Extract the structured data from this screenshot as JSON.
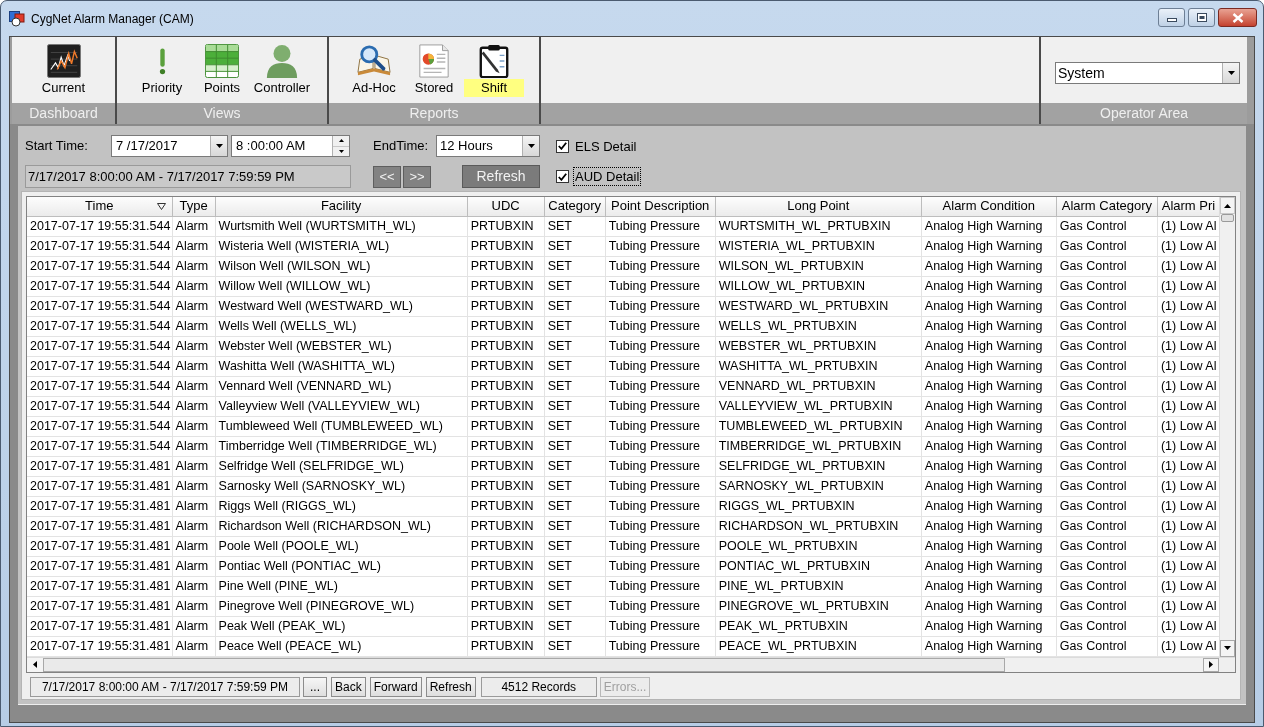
{
  "window": {
    "title": "CygNet Alarm Manager (CAM)"
  },
  "toolbar": {
    "groups": [
      {
        "label": "Dashboard",
        "items": [
          {
            "label": "Current",
            "selected": false
          }
        ]
      },
      {
        "label": "Views",
        "items": [
          {
            "label": "Priority",
            "selected": false
          },
          {
            "label": "Points",
            "selected": false
          },
          {
            "label": "Controller",
            "selected": false
          }
        ]
      },
      {
        "label": "Reports",
        "items": [
          {
            "label": "Ad-Hoc",
            "selected": false
          },
          {
            "label": "Stored",
            "selected": false
          },
          {
            "label": "Shift",
            "selected": true
          }
        ]
      }
    ]
  },
  "operator_area": {
    "label": "Operator Area",
    "value": "System"
  },
  "filters": {
    "start_label": "Start Time:",
    "start_date": "7 /17/2017",
    "start_time": "8 :00:00 AM",
    "end_label": "EndTime:",
    "end_value": "12 Hours",
    "range": "7/17/2017 8:00:00 AM - 7/17/2017 7:59:59 PM",
    "prev_button": "<<",
    "next_button": ">>",
    "refresh_button": "Refresh",
    "options": [
      {
        "label": "ELS Detail",
        "checked": true,
        "focused": false
      },
      {
        "label": "AUD Detail",
        "checked": true,
        "focused": true
      }
    ]
  },
  "table": {
    "columns": [
      {
        "label": "Time",
        "sorted": true
      },
      {
        "label": "Type",
        "sorted": false
      },
      {
        "label": "Facility",
        "sorted": false
      },
      {
        "label": "UDC",
        "sorted": false
      },
      {
        "label": "Category",
        "sorted": false
      },
      {
        "label": "Point Description",
        "sorted": false
      },
      {
        "label": "Long Point",
        "sorted": false
      },
      {
        "label": "Alarm Condition",
        "sorted": false
      },
      {
        "label": "Alarm Category",
        "sorted": false
      },
      {
        "label": "Alarm Pri",
        "sorted": false
      }
    ],
    "rows": [
      [
        "2017-07-17 19:55:31.544",
        "Alarm",
        "Wurtsmith Well (WURTSMITH_WL)",
        "PRTUBXIN",
        "SET",
        "Tubing Pressure",
        "WURTSMITH_WL_PRTUBXIN",
        "Analog High Warning",
        "Gas Control",
        "(1) Low Al"
      ],
      [
        "2017-07-17 19:55:31.544",
        "Alarm",
        "Wisteria Well (WISTERIA_WL)",
        "PRTUBXIN",
        "SET",
        "Tubing Pressure",
        "WISTERIA_WL_PRTUBXIN",
        "Analog High Warning",
        "Gas Control",
        "(1) Low Al"
      ],
      [
        "2017-07-17 19:55:31.544",
        "Alarm",
        "Wilson Well (WILSON_WL)",
        "PRTUBXIN",
        "SET",
        "Tubing Pressure",
        "WILSON_WL_PRTUBXIN",
        "Analog High Warning",
        "Gas Control",
        "(1) Low Al"
      ],
      [
        "2017-07-17 19:55:31.544",
        "Alarm",
        "Willow Well (WILLOW_WL)",
        "PRTUBXIN",
        "SET",
        "Tubing Pressure",
        "WILLOW_WL_PRTUBXIN",
        "Analog High Warning",
        "Gas Control",
        "(1) Low Al"
      ],
      [
        "2017-07-17 19:55:31.544",
        "Alarm",
        "Westward Well (WESTWARD_WL)",
        "PRTUBXIN",
        "SET",
        "Tubing Pressure",
        "WESTWARD_WL_PRTUBXIN",
        "Analog High Warning",
        "Gas Control",
        "(1) Low Al"
      ],
      [
        "2017-07-17 19:55:31.544",
        "Alarm",
        "Wells Well (WELLS_WL)",
        "PRTUBXIN",
        "SET",
        "Tubing Pressure",
        "WELLS_WL_PRTUBXIN",
        "Analog High Warning",
        "Gas Control",
        "(1) Low Al"
      ],
      [
        "2017-07-17 19:55:31.544",
        "Alarm",
        "Webster Well (WEBSTER_WL)",
        "PRTUBXIN",
        "SET",
        "Tubing Pressure",
        "WEBSTER_WL_PRTUBXIN",
        "Analog High Warning",
        "Gas Control",
        "(1) Low Al"
      ],
      [
        "2017-07-17 19:55:31.544",
        "Alarm",
        "Washitta Well (WASHITTA_WL)",
        "PRTUBXIN",
        "SET",
        "Tubing Pressure",
        "WASHITTA_WL_PRTUBXIN",
        "Analog High Warning",
        "Gas Control",
        "(1) Low Al"
      ],
      [
        "2017-07-17 19:55:31.544",
        "Alarm",
        "Vennard Well (VENNARD_WL)",
        "PRTUBXIN",
        "SET",
        "Tubing Pressure",
        "VENNARD_WL_PRTUBXIN",
        "Analog High Warning",
        "Gas Control",
        "(1) Low Al"
      ],
      [
        "2017-07-17 19:55:31.544",
        "Alarm",
        "Valleyview Well (VALLEYVIEW_WL)",
        "PRTUBXIN",
        "SET",
        "Tubing Pressure",
        "VALLEYVIEW_WL_PRTUBXIN",
        "Analog High Warning",
        "Gas Control",
        "(1) Low Al"
      ],
      [
        "2017-07-17 19:55:31.544",
        "Alarm",
        "Tumbleweed Well (TUMBLEWEED_WL)",
        "PRTUBXIN",
        "SET",
        "Tubing Pressure",
        "TUMBLEWEED_WL_PRTUBXIN",
        "Analog High Warning",
        "Gas Control",
        "(1) Low Al"
      ],
      [
        "2017-07-17 19:55:31.544",
        "Alarm",
        "Timberridge Well (TIMBERRIDGE_WL)",
        "PRTUBXIN",
        "SET",
        "Tubing Pressure",
        "TIMBERRIDGE_WL_PRTUBXIN",
        "Analog High Warning",
        "Gas Control",
        "(1) Low Al"
      ],
      [
        "2017-07-17 19:55:31.481",
        "Alarm",
        "Selfridge Well (SELFRIDGE_WL)",
        "PRTUBXIN",
        "SET",
        "Tubing Pressure",
        "SELFRIDGE_WL_PRTUBXIN",
        "Analog High Warning",
        "Gas Control",
        "(1) Low Al"
      ],
      [
        "2017-07-17 19:55:31.481",
        "Alarm",
        "Sarnosky Well (SARNOSKY_WL)",
        "PRTUBXIN",
        "SET",
        "Tubing Pressure",
        "SARNOSKY_WL_PRTUBXIN",
        "Analog High Warning",
        "Gas Control",
        "(1) Low Al"
      ],
      [
        "2017-07-17 19:55:31.481",
        "Alarm",
        "Riggs Well (RIGGS_WL)",
        "PRTUBXIN",
        "SET",
        "Tubing Pressure",
        "RIGGS_WL_PRTUBXIN",
        "Analog High Warning",
        "Gas Control",
        "(1) Low Al"
      ],
      [
        "2017-07-17 19:55:31.481",
        "Alarm",
        "Richardson Well (RICHARDSON_WL)",
        "PRTUBXIN",
        "SET",
        "Tubing Pressure",
        "RICHARDSON_WL_PRTUBXIN",
        "Analog High Warning",
        "Gas Control",
        "(1) Low Al"
      ],
      [
        "2017-07-17 19:55:31.481",
        "Alarm",
        "Poole Well (POOLE_WL)",
        "PRTUBXIN",
        "SET",
        "Tubing Pressure",
        "POOLE_WL_PRTUBXIN",
        "Analog High Warning",
        "Gas Control",
        "(1) Low Al"
      ],
      [
        "2017-07-17 19:55:31.481",
        "Alarm",
        "Pontiac Well (PONTIAC_WL)",
        "PRTUBXIN",
        "SET",
        "Tubing Pressure",
        "PONTIAC_WL_PRTUBXIN",
        "Analog High Warning",
        "Gas Control",
        "(1) Low Al"
      ],
      [
        "2017-07-17 19:55:31.481",
        "Alarm",
        "Pine Well (PINE_WL)",
        "PRTUBXIN",
        "SET",
        "Tubing Pressure",
        "PINE_WL_PRTUBXIN",
        "Analog High Warning",
        "Gas Control",
        "(1) Low Al"
      ],
      [
        "2017-07-17 19:55:31.481",
        "Alarm",
        "Pinegrove Well (PINEGROVE_WL)",
        "PRTUBXIN",
        "SET",
        "Tubing Pressure",
        "PINEGROVE_WL_PRTUBXIN",
        "Analog High Warning",
        "Gas Control",
        "(1) Low Al"
      ],
      [
        "2017-07-17 19:55:31.481",
        "Alarm",
        "Peak Well (PEAK_WL)",
        "PRTUBXIN",
        "SET",
        "Tubing Pressure",
        "PEAK_WL_PRTUBXIN",
        "Analog High Warning",
        "Gas Control",
        "(1) Low Al"
      ],
      [
        "2017-07-17 19:55:31.481",
        "Alarm",
        "Peace Well (PEACE_WL)",
        "PRTUBXIN",
        "SET",
        "Tubing Pressure",
        "PEACE_WL_PRTUBXIN",
        "Analog High Warning",
        "Gas Control",
        "(1) Low Al"
      ]
    ]
  },
  "status_bar": {
    "range": "7/17/2017 8:00:00 AM - 7/17/2017 7:59:59 PM",
    "browse_button": "...",
    "buttons": [
      "Back",
      "Forward",
      "Refresh"
    ],
    "records": "4512 Records",
    "errors_button": {
      "label": "Errors...",
      "disabled": true
    }
  }
}
